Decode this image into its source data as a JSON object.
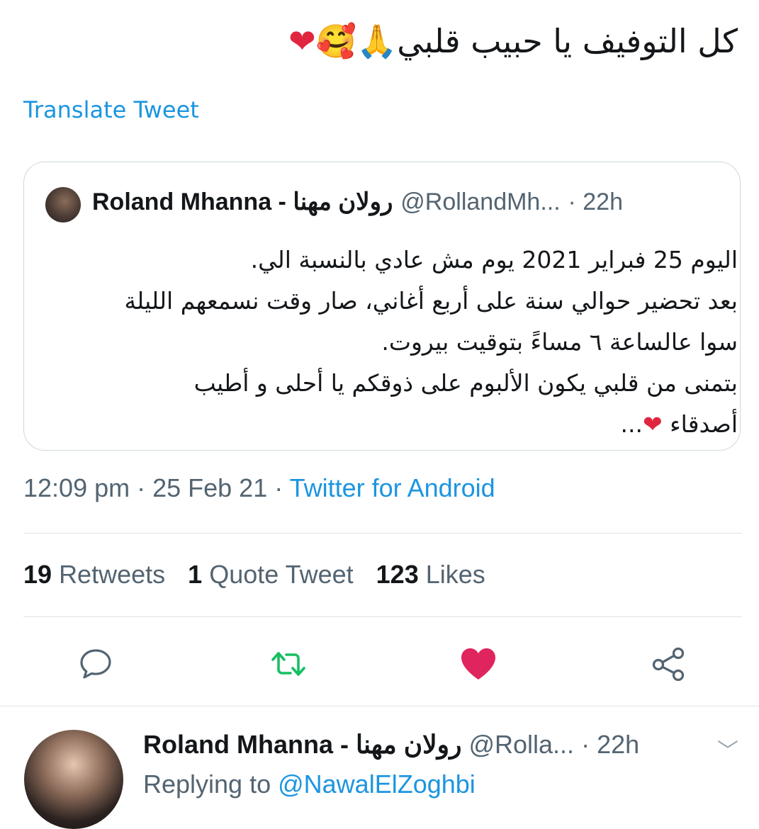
{
  "tweet": {
    "text": "كل التوفيف يا حبيب قلبي🙏🥰",
    "heart": "❤",
    "translate_label": "Translate Tweet"
  },
  "quote": {
    "name": "Roland Mhanna - رولان مهنا",
    "handle": "@RollandMh...",
    "time": "· 22h",
    "lines": [
      "اليوم 25 فبراير 2021 يوم مش عادي بالنسبة الي.",
      "بعد تحضير حوالي سنة على أربع أغاني، صار وقت نسمعهم الليلة",
      "سوا عالساعة ٦ مساءً بتوقيت بيروت.",
      "بتمنى من قلبي يكون الألبوم على ذوقكم يا أحلى و أطيب",
      "أصدقاء"
    ],
    "last_suffix": "..."
  },
  "meta": {
    "time": "12:09 pm · 25 Feb 21 · ",
    "source": "Twitter for Android"
  },
  "stats": {
    "retweets_count": "19",
    "retweets_label": "Retweets",
    "quotes_count": "1",
    "quotes_label": "Quote Tweet",
    "likes_count": "123",
    "likes_label": "Likes"
  },
  "actions": {
    "reply_icon": "speech-bubble-icon",
    "retweet_icon": "retweet-icon",
    "like_icon": "heart-filled-icon",
    "share_icon": "share-icon",
    "like_color": "#e0245e",
    "retweet_color": "#17bf63"
  },
  "reply": {
    "name": "Roland Mhanna - رولان مهنا",
    "handle": "@Rolla...",
    "time": "· 22h",
    "replying_prefix": "Replying to ",
    "replying_to": "@NawalElZoghbi"
  }
}
